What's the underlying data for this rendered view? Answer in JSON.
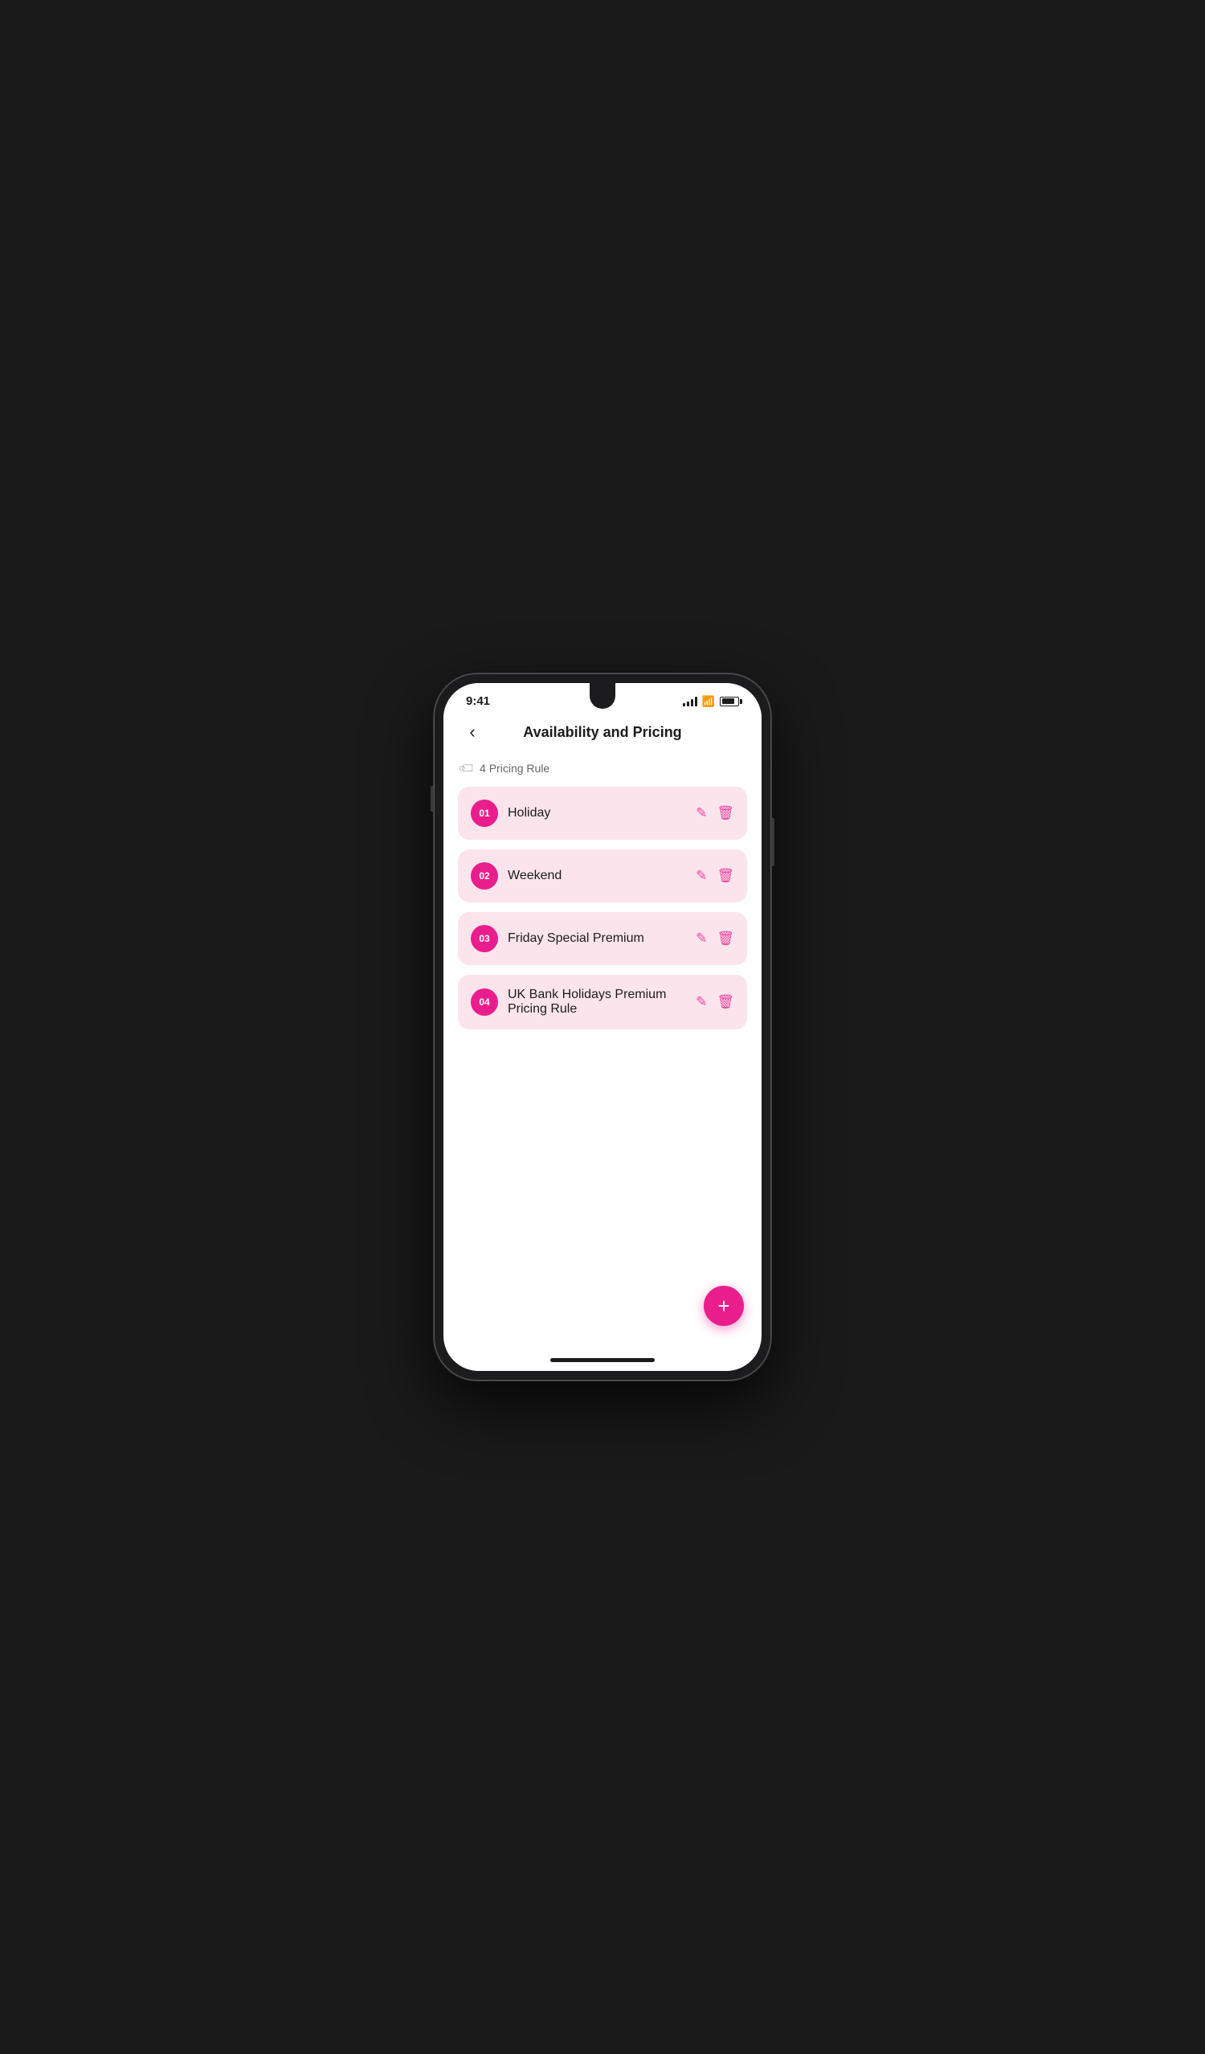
{
  "status": {
    "time": "9:41"
  },
  "header": {
    "title": "Availability and Pricing",
    "back_label": "‹"
  },
  "rule_count": {
    "label": "4 Pricing Rule",
    "icon": "tag"
  },
  "rules": [
    {
      "number": "01",
      "label": "Holiday",
      "edit_icon": "✎",
      "delete_icon": "🗑"
    },
    {
      "number": "02",
      "label": "Weekend",
      "edit_icon": "✎",
      "delete_icon": "🗑"
    },
    {
      "number": "03",
      "label": "Friday Special Premium",
      "edit_icon": "✎",
      "delete_icon": "🗑"
    },
    {
      "number": "04",
      "label": "UK Bank Holidays Premium Pricing Rule",
      "edit_icon": "✎",
      "delete_icon": "🗑"
    }
  ],
  "fab": {
    "label": "+"
  },
  "colors": {
    "accent": "#e91e8c",
    "card_bg": "#fce4ec",
    "badge_bg": "#e91e8c"
  }
}
